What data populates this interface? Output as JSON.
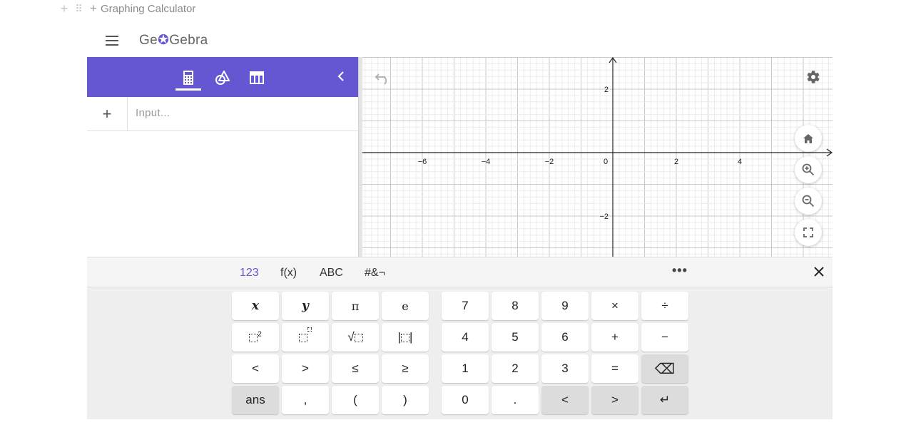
{
  "notion_block": {
    "plus_icon": "+",
    "drag_handle": "⠿",
    "add_icon": "+",
    "title": "Graphing Calculator"
  },
  "header": {
    "logo_prefix": "Ge",
    "logo_o": "✪",
    "logo_suffix": "Gebra"
  },
  "algebra": {
    "tabs": [
      "algebra-calculator-icon",
      "tools-icon",
      "table-icon"
    ],
    "active_tab": 0,
    "input_plus": "+",
    "input_placeholder": "Input..."
  },
  "graph": {
    "x_tick_labels": [
      "−6",
      "−4",
      "−2",
      "0",
      "2",
      "4"
    ],
    "y_tick_labels": [
      "2",
      "−2"
    ],
    "colors": {
      "accent": "#6557d2",
      "grid_major": "#c9c9c9",
      "grid_minor": "#ececec"
    }
  },
  "keyboard": {
    "tabs": [
      "123",
      "f(x)",
      "ABC",
      "#&¬"
    ],
    "active_tab": "123",
    "more": "•••",
    "left_keys": [
      [
        "x",
        "y",
        "π",
        "e"
      ],
      [
        "x²",
        "xⁿ",
        "√",
        "|x|"
      ],
      [
        "<",
        ">",
        "≤",
        "≥"
      ],
      [
        "ans",
        ",",
        "(",
        ")"
      ]
    ],
    "right_keys": [
      [
        "7",
        "8",
        "9",
        "×",
        "÷"
      ],
      [
        "4",
        "5",
        "6",
        "+",
        "−"
      ],
      [
        "1",
        "2",
        "3",
        "=",
        "⌫"
      ],
      [
        "0",
        ".",
        "<",
        ">",
        "↵"
      ]
    ]
  }
}
